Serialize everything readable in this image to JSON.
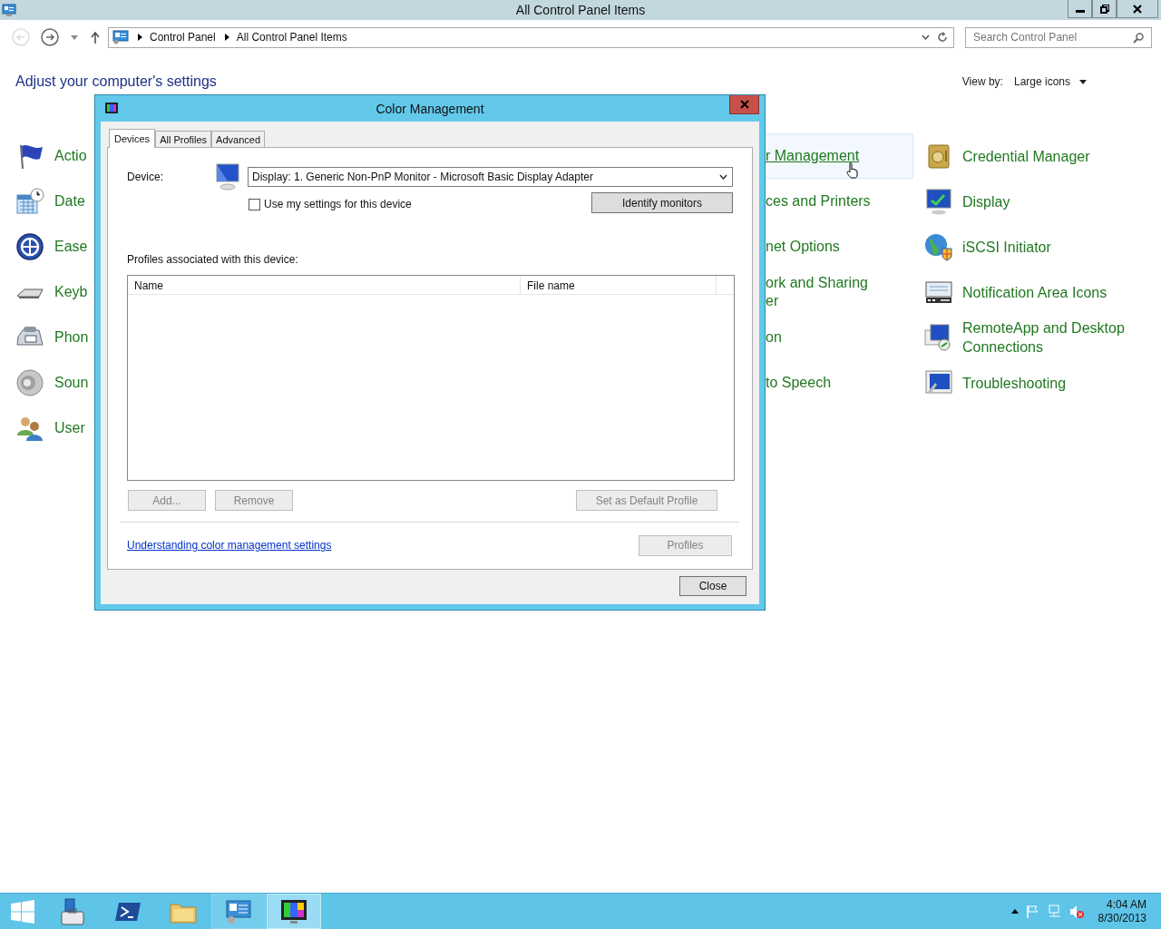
{
  "window": {
    "title": "All Control Panel Items"
  },
  "nav": {
    "breadcrumbs": [
      "Control Panel",
      "All Control Panel Items"
    ],
    "search": {
      "placeholder": "Search Control Panel"
    }
  },
  "heading": "Adjust your computer's settings",
  "view_by": {
    "label": "View by:",
    "value": "Large icons"
  },
  "columns": [
    {
      "items": [
        {
          "label": "Actio"
        },
        {
          "label": "Date"
        },
        {
          "label": "Ease"
        },
        {
          "label": "Keyb"
        },
        {
          "label": "Phon"
        },
        {
          "label": "Soun"
        },
        {
          "label": "User"
        }
      ]
    },
    {
      "items": [
        {
          "label": "r Management",
          "highlighted": true
        },
        {
          "label": "ces and Printers",
          "highlighted": false
        },
        {
          "label": "net Options",
          "highlighted": false
        },
        {
          "label": "ork and Sharing er",
          "highlighted": false
        },
        {
          "label": "on",
          "highlighted": false
        },
        {
          "label": "to Speech",
          "highlighted": false
        }
      ]
    },
    {
      "items": [
        {
          "label": "Credential Manager"
        },
        {
          "label": "Display"
        },
        {
          "label": "iSCSI Initiator"
        },
        {
          "label": "Notification Area Icons"
        },
        {
          "label": "RemoteApp and Desktop Connections"
        },
        {
          "label": "Troubleshooting"
        }
      ]
    }
  ],
  "dialog": {
    "title": "Color Management",
    "tabs": [
      {
        "label": "Devices",
        "selected": true
      },
      {
        "label": "All Profiles",
        "selected": false
      },
      {
        "label": "Advanced",
        "selected": false
      }
    ],
    "device_label": "Device:",
    "device_value": "Display: 1. Generic Non-PnP Monitor - Microsoft Basic Display Adapter",
    "use_my_settings": {
      "label": "Use my settings for this device",
      "checked": false
    },
    "identify_button": "Identify monitors",
    "profiles_label": "Profiles associated with this device:",
    "profiles_table": {
      "columns": [
        "Name",
        "File name"
      ]
    },
    "profile_buttons": [
      {
        "label": "Add...",
        "disabled": true
      },
      {
        "label": "Remove",
        "disabled": true
      },
      {
        "label": "Set as Default Profile",
        "disabled": true
      }
    ],
    "link": "Understanding color management settings",
    "profiles_button": {
      "label": "Profiles",
      "disabled": true
    },
    "close_button": "Close"
  },
  "taskbar": {
    "items": [
      {
        "open": false,
        "selected": false
      },
      {
        "open": false,
        "selected": false
      },
      {
        "open": false,
        "selected": false
      },
      {
        "open": true,
        "selected": false
      },
      {
        "open": true,
        "selected": true
      }
    ]
  },
  "clock": {
    "time": "4:04 AM",
    "date": "8/30/2013"
  }
}
